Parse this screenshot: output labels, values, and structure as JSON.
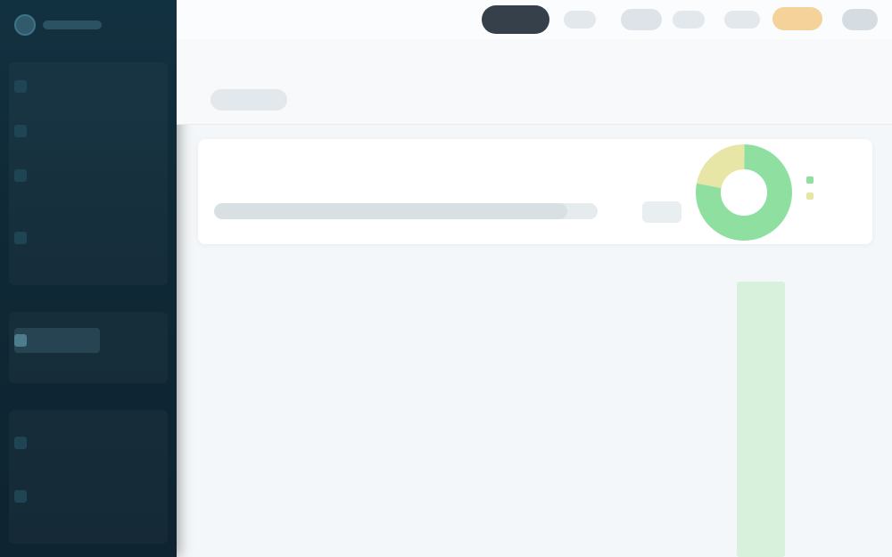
{
  "app": {
    "name": "",
    "title": "",
    "subtitle": ""
  },
  "sidebar": {
    "items": [
      {
        "label": "",
        "icon": "home-icon",
        "active": false
      },
      {
        "label": "",
        "icon": "list-icon",
        "active": false
      },
      {
        "label": "",
        "icon": "chart-icon",
        "active": false
      },
      {
        "label": "",
        "icon": "folder-icon",
        "active": false
      },
      {
        "label": "",
        "icon": "check-icon",
        "active": true
      },
      {
        "label": "",
        "icon": "users-icon",
        "active": false
      },
      {
        "label": "",
        "icon": "settings-icon",
        "active": false
      }
    ]
  },
  "topbar": {
    "primary_button": "",
    "tabs": [
      "",
      "",
      "",
      ""
    ],
    "highlight_button": "",
    "user_button": ""
  },
  "filters": {
    "chip": ""
  },
  "summary": {
    "title": "",
    "progress": 0.92,
    "button": "",
    "donut": [
      {
        "name": "",
        "value": 78,
        "color": "#8fe0a0"
      },
      {
        "name": "",
        "value": 22,
        "color": "#e8e6a6"
      }
    ],
    "legend_color_a": "#8fe0a0",
    "legend_color_b": "#e8e6a6"
  },
  "table": {
    "headers": [
      "",
      "",
      "",
      ""
    ],
    "rows": [
      {
        "name": "",
        "col2": "",
        "col3": "",
        "status": ""
      },
      {
        "name": "",
        "col2": "",
        "col3": "",
        "status": ""
      },
      {
        "name": "",
        "col2": "",
        "col3": "",
        "status": ""
      },
      {
        "name": "",
        "col2": "",
        "col3": "",
        "status": ""
      },
      {
        "name": "",
        "col2": "",
        "col3": "",
        "status": ""
      },
      {
        "name": "",
        "col2": "",
        "col3": "",
        "status": ""
      },
      {
        "name": "",
        "col2": "",
        "col3": "",
        "status": ""
      },
      {
        "name": "",
        "col2": "",
        "col3": "",
        "status": ""
      },
      {
        "name": "",
        "col2": "",
        "col3": "",
        "status": ""
      },
      {
        "name": "",
        "col2": "",
        "col3": "",
        "status": ""
      },
      {
        "name": "",
        "col2": "",
        "col3": "",
        "status": ""
      },
      {
        "name": "",
        "col2": "",
        "col3": "",
        "status": ""
      },
      {
        "name": "",
        "col2": "",
        "col3": "",
        "status": ""
      }
    ],
    "status_color": "#d8f1dc"
  }
}
